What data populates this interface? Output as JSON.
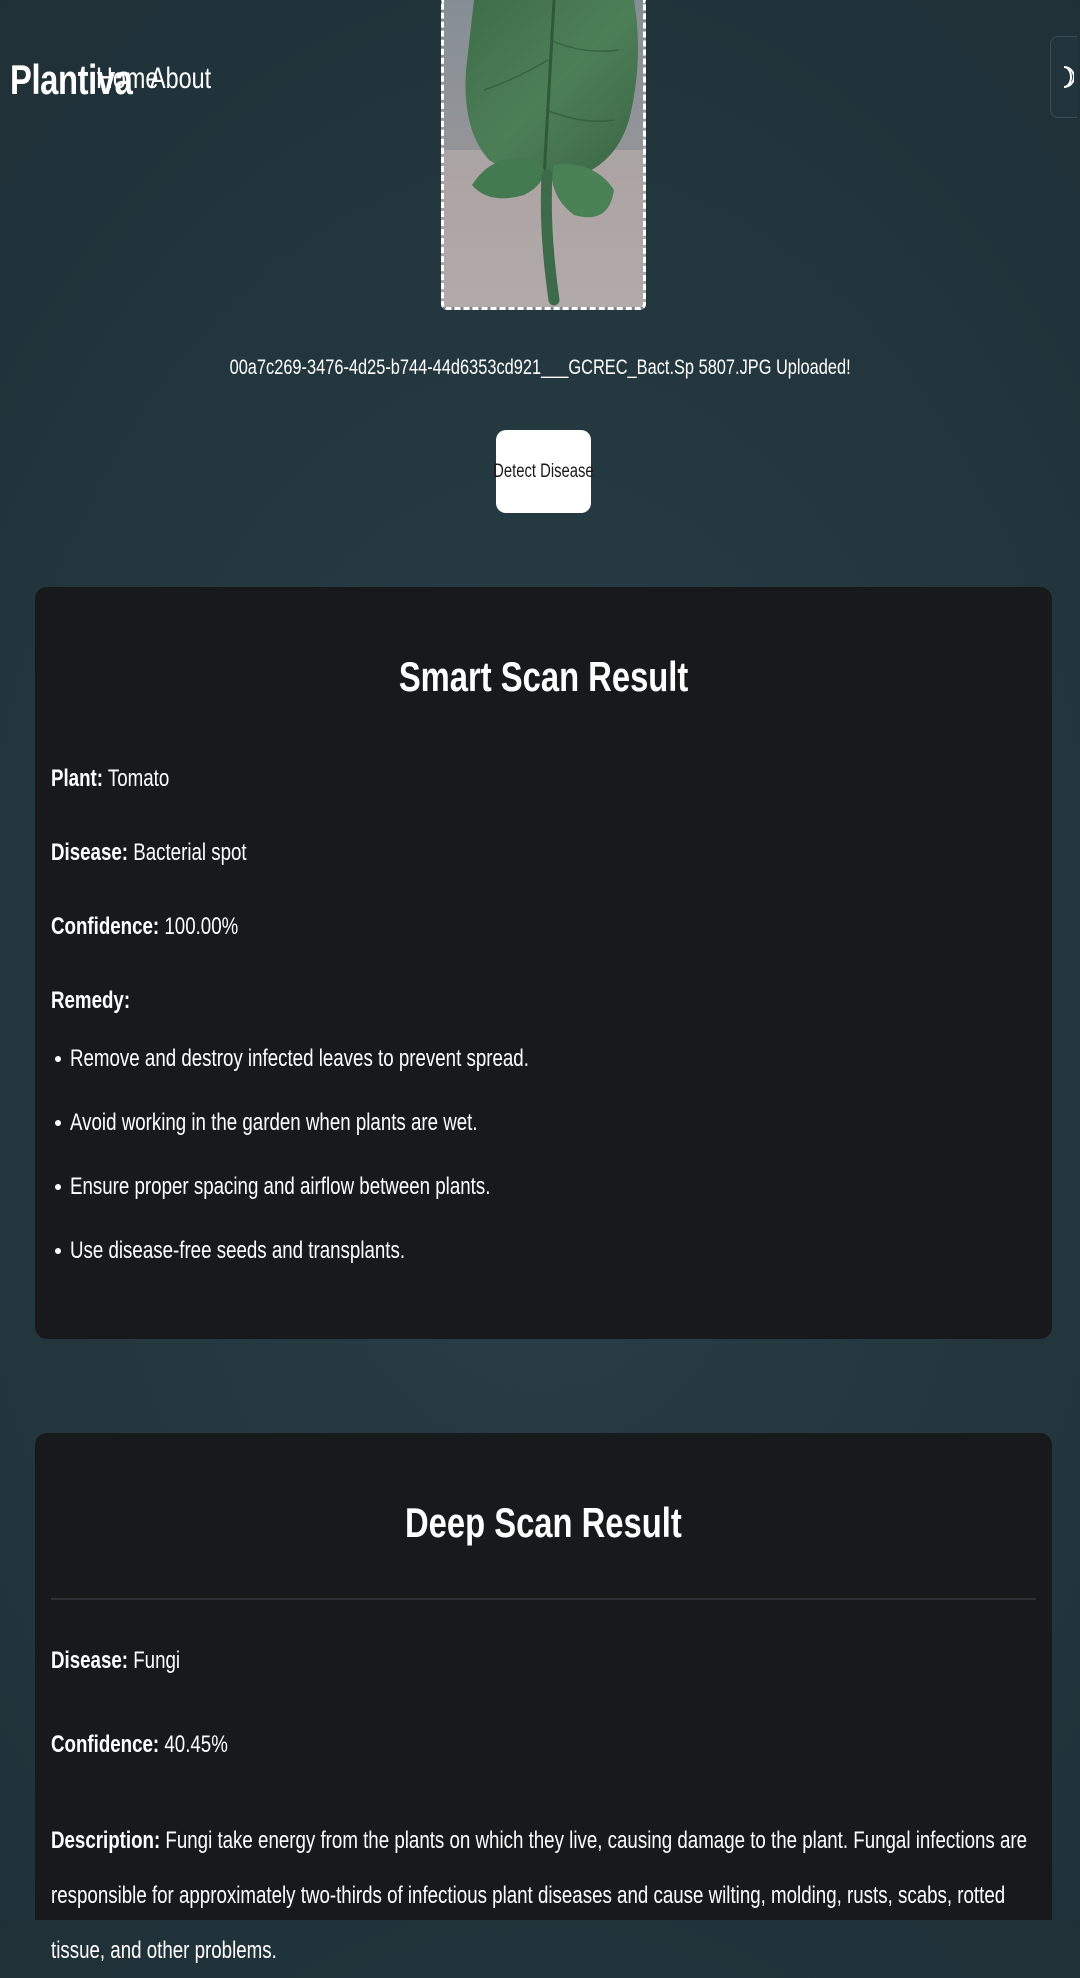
{
  "nav": {
    "brand": "Plantiva",
    "links": [
      {
        "label": "Home"
      },
      {
        "label": "About"
      }
    ],
    "theme_toggle_icon": "moon-icon"
  },
  "upload": {
    "status_text": "00a7c269-3476-4d25-b744-44d6353cd921___GCREC_Bact.Sp 5807.JPG Uploaded!",
    "detect_button_label": "Detect Disease"
  },
  "smart_scan": {
    "title": "Smart Scan Result",
    "plant_label": "Plant:",
    "plant_value": "Tomato",
    "disease_label": "Disease:",
    "disease_value": "Bacterial spot",
    "confidence_label": "Confidence:",
    "confidence_value": "100.00%",
    "remedy_label": "Remedy:",
    "remedies": [
      "Remove and destroy infected leaves to prevent spread.",
      "Avoid working in the garden when plants are wet.",
      "Ensure proper spacing and airflow between plants.",
      "Use disease-free seeds and transplants."
    ]
  },
  "deep_scan": {
    "title": "Deep Scan Result",
    "disease_label": "Disease:",
    "disease_value": "Fungi",
    "confidence_label": "Confidence:",
    "confidence_value": "40.45%",
    "description_label": "Description:",
    "description_value": "Fungi take energy from the plants on which they live, causing damage to the plant. Fungal infections are responsible for approximately two-thirds of infectious plant diseases and cause wilting, molding, rusts, scabs, rotted tissue, and other problems."
  },
  "colors": {
    "background": "#243840",
    "card": "#18191b",
    "button": "#ffffff",
    "text": "#ffffff"
  }
}
